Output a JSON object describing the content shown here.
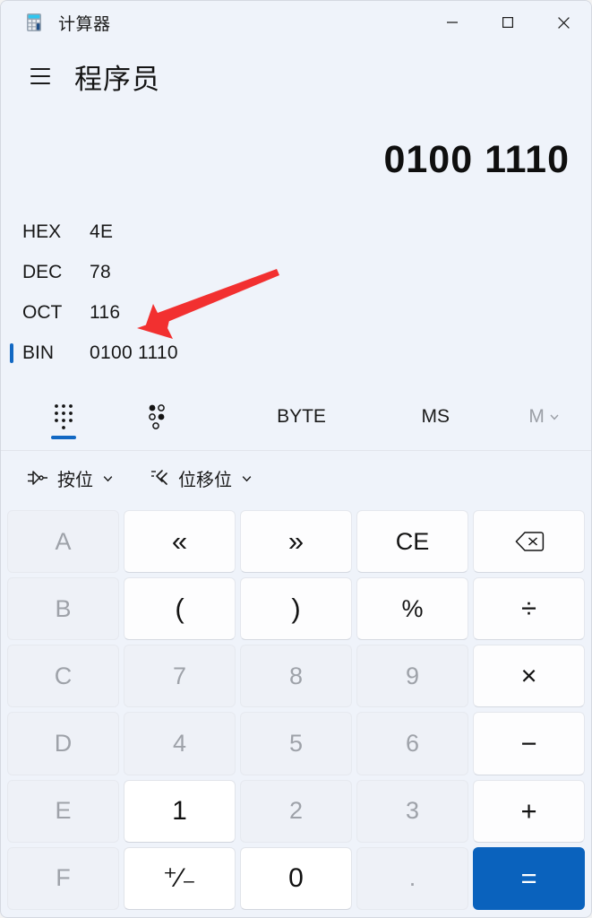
{
  "window": {
    "app_icon": "calculator-icon",
    "title": "计算器",
    "controls": {
      "minimize": "minimize-icon",
      "maximize": "maximize-icon",
      "close": "close-icon"
    }
  },
  "header": {
    "menu_icon": "hamburger-menu-icon",
    "mode_title": "程序员"
  },
  "display": {
    "value": "0100 1110"
  },
  "radix": {
    "active": "BIN",
    "rows": [
      {
        "label": "HEX",
        "value": "4E"
      },
      {
        "label": "DEC",
        "value": "78"
      },
      {
        "label": "OCT",
        "value": "116"
      },
      {
        "label": "BIN",
        "value": "0100 1110"
      }
    ]
  },
  "tabs": {
    "keypad": {
      "icon": "keypad-dots-icon",
      "selected": true
    },
    "bit_toggle": {
      "icon": "bit-toggle-icon",
      "selected": false
    },
    "word_size": {
      "label": "BYTE"
    },
    "memory_store": {
      "label": "MS"
    },
    "memory_menu": {
      "label": "M",
      "icon": "chevron-down-icon",
      "disabled": true
    }
  },
  "operators": {
    "bitwise": {
      "icon": "logic-gate-icon",
      "label": "按位",
      "chevron": "chevron-down-icon"
    },
    "bitshift": {
      "icon": "bit-shift-icon",
      "label": "位移位",
      "chevron": "chevron-down-icon"
    }
  },
  "keypad": {
    "rows": [
      [
        {
          "name": "key-a",
          "label": "A",
          "state": "disabled"
        },
        {
          "name": "key-shift-left",
          "label": "«",
          "state": "enabled"
        },
        {
          "name": "key-shift-right",
          "label": "»",
          "state": "enabled"
        },
        {
          "name": "key-clear-entry",
          "label": "CE",
          "state": "enabled"
        },
        {
          "name": "key-backspace",
          "label": "",
          "state": "enabled",
          "icon": "backspace-icon"
        }
      ],
      [
        {
          "name": "key-b",
          "label": "B",
          "state": "disabled"
        },
        {
          "name": "key-open-paren",
          "label": "(",
          "state": "enabled"
        },
        {
          "name": "key-close-paren",
          "label": ")",
          "state": "enabled"
        },
        {
          "name": "key-percent",
          "label": "%",
          "state": "enabled"
        },
        {
          "name": "key-divide",
          "label": "÷",
          "state": "enabled"
        }
      ],
      [
        {
          "name": "key-c",
          "label": "C",
          "state": "disabled"
        },
        {
          "name": "key-7",
          "label": "7",
          "state": "disabled"
        },
        {
          "name": "key-8",
          "label": "8",
          "state": "disabled"
        },
        {
          "name": "key-9",
          "label": "9",
          "state": "disabled"
        },
        {
          "name": "key-multiply",
          "label": "×",
          "state": "enabled"
        }
      ],
      [
        {
          "name": "key-d",
          "label": "D",
          "state": "disabled"
        },
        {
          "name": "key-4",
          "label": "4",
          "state": "disabled"
        },
        {
          "name": "key-5",
          "label": "5",
          "state": "disabled"
        },
        {
          "name": "key-6",
          "label": "6",
          "state": "disabled"
        },
        {
          "name": "key-subtract",
          "label": "−",
          "state": "enabled"
        }
      ],
      [
        {
          "name": "key-e",
          "label": "E",
          "state": "disabled"
        },
        {
          "name": "key-1",
          "label": "1",
          "state": "num-enabled"
        },
        {
          "name": "key-2",
          "label": "2",
          "state": "disabled"
        },
        {
          "name": "key-3",
          "label": "3",
          "state": "disabled"
        },
        {
          "name": "key-add",
          "label": "+",
          "state": "enabled"
        }
      ],
      [
        {
          "name": "key-f",
          "label": "F",
          "state": "disabled"
        },
        {
          "name": "key-negate",
          "label": "⁺⁄₋",
          "state": "num-enabled"
        },
        {
          "name": "key-0",
          "label": "0",
          "state": "num-enabled"
        },
        {
          "name": "key-decimal",
          "label": ".",
          "state": "disabled"
        },
        {
          "name": "key-equals",
          "label": "=",
          "state": "accent"
        }
      ]
    ]
  },
  "annotation": {
    "arrow_color": "#f23030",
    "points_at": "OCT"
  },
  "colors": {
    "accent": "#0a62bd",
    "window_background": "#eff3fa",
    "selected_indicator": "#1268c3"
  }
}
